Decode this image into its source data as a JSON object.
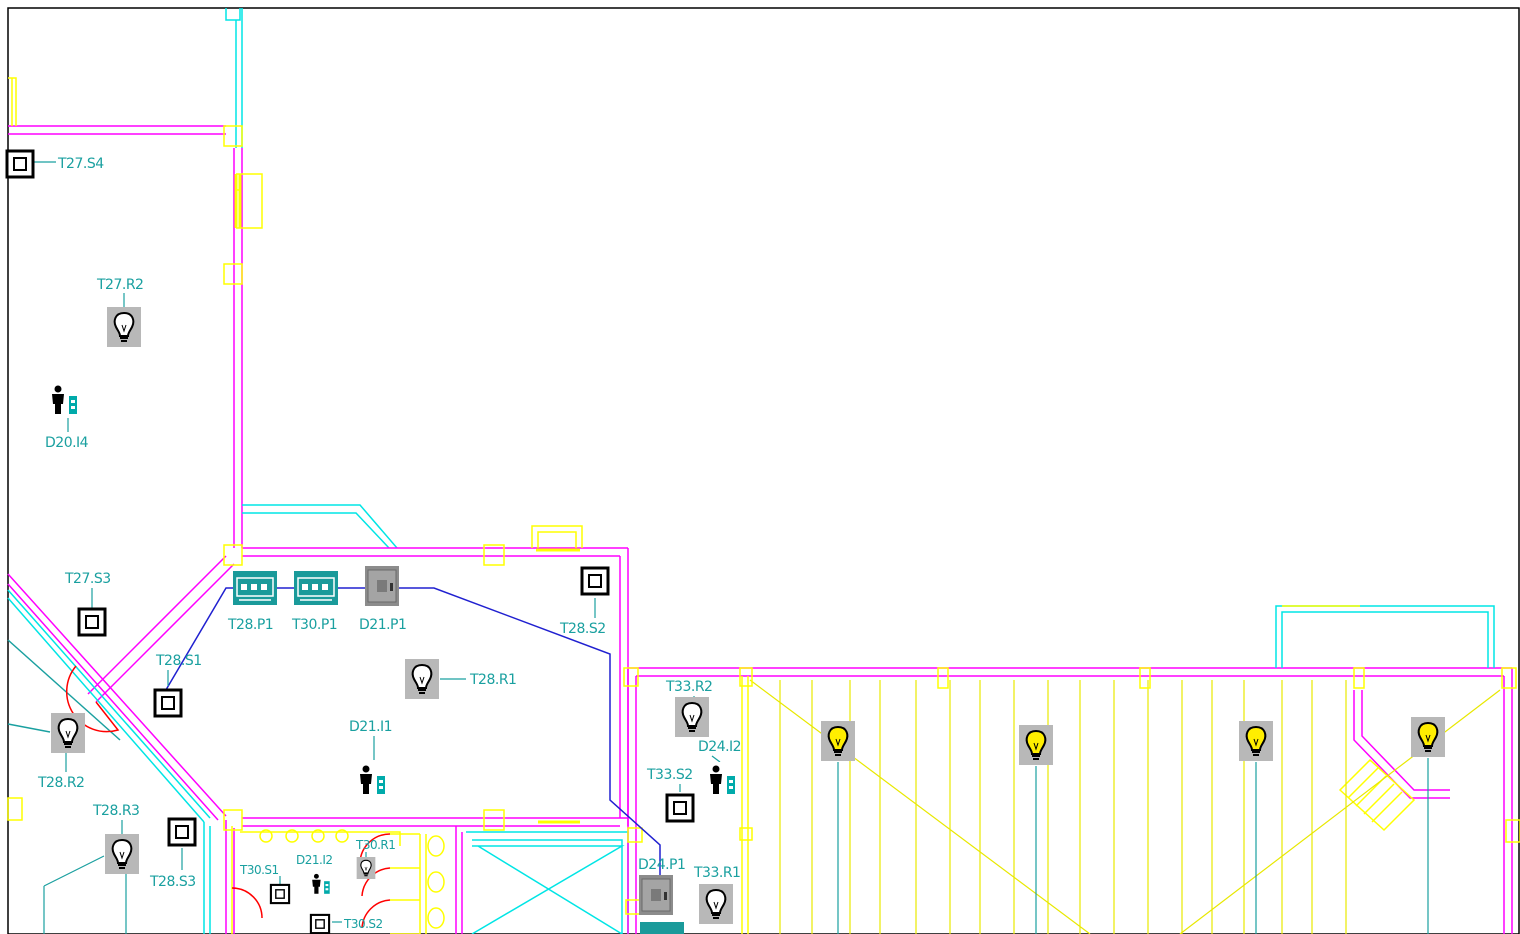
{
  "labels": {
    "t27_s4": "T27.S4",
    "t27_r2": "T27.R2",
    "d20_i4": "D20.I4",
    "t27_s3": "T27.S3",
    "t28_p1": "T28.P1",
    "t30_p1": "T30.P1",
    "d21_p1": "D21.P1",
    "t28_s2": "T28.S2",
    "t28_s1": "T28.S1",
    "t28_r1": "T28.R1",
    "d21_i1": "D21.I1",
    "t28_r2": "T28.R2",
    "t28_r3": "T28.R3",
    "t28_s3": "T28.S3",
    "t30_s1": "T30.S1",
    "d21_i2": "D21.I2",
    "t30_r1": "T30.R1",
    "t30_s2": "T30.S2",
    "t33_r2": "T33.R2",
    "d24_i2": "D24.I2",
    "t33_s2": "T33.S2",
    "d24_p1": "D24.P1",
    "t33_r1": "T33.R1"
  },
  "colors": {
    "wall_magenta": "#ff00ff",
    "wall_cyan": "#00e5e5",
    "column_yellow": "#ffff00",
    "hatch_yellow": "#e8e800",
    "label_teal": "#1aa0a0",
    "cable_blue": "#2020d0",
    "lamp_on_yellow": "#ffee00",
    "icon_grey_bg": "#b8b8b8",
    "door_red": "#ff0000"
  },
  "icons": [
    "light-bulb-icon",
    "presence-sensor-icon",
    "switch-icon",
    "panel-device-icon",
    "cabinet-icon"
  ]
}
